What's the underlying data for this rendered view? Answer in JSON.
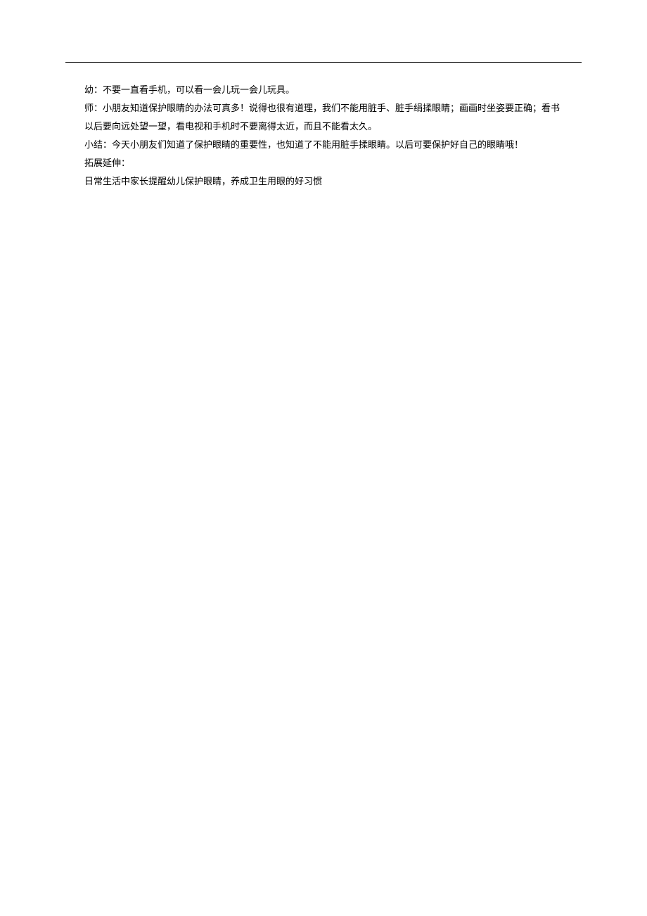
{
  "lines": [
    "幼：不要一直看手机，可以看一会儿玩一会儿玩具。",
    "师：小朋友知道保护眼睛的办法可真多！说得也很有道理，我们不能用脏手、脏手绢揉眼睛；画画时坐姿要正确；看书",
    "以后要向远处望一望，看电视和手机时不要离得太近，而且不能看太久。",
    "小结：今天小朋友们知道了保护眼睛的重要性，也知道了不能用脏手揉眼睛。以后可要保护好自己的眼睛哦！",
    "拓展延伸：",
    "日常生活中家长提醒幼儿保护眼睛，养成卫生用眼的好习惯"
  ]
}
